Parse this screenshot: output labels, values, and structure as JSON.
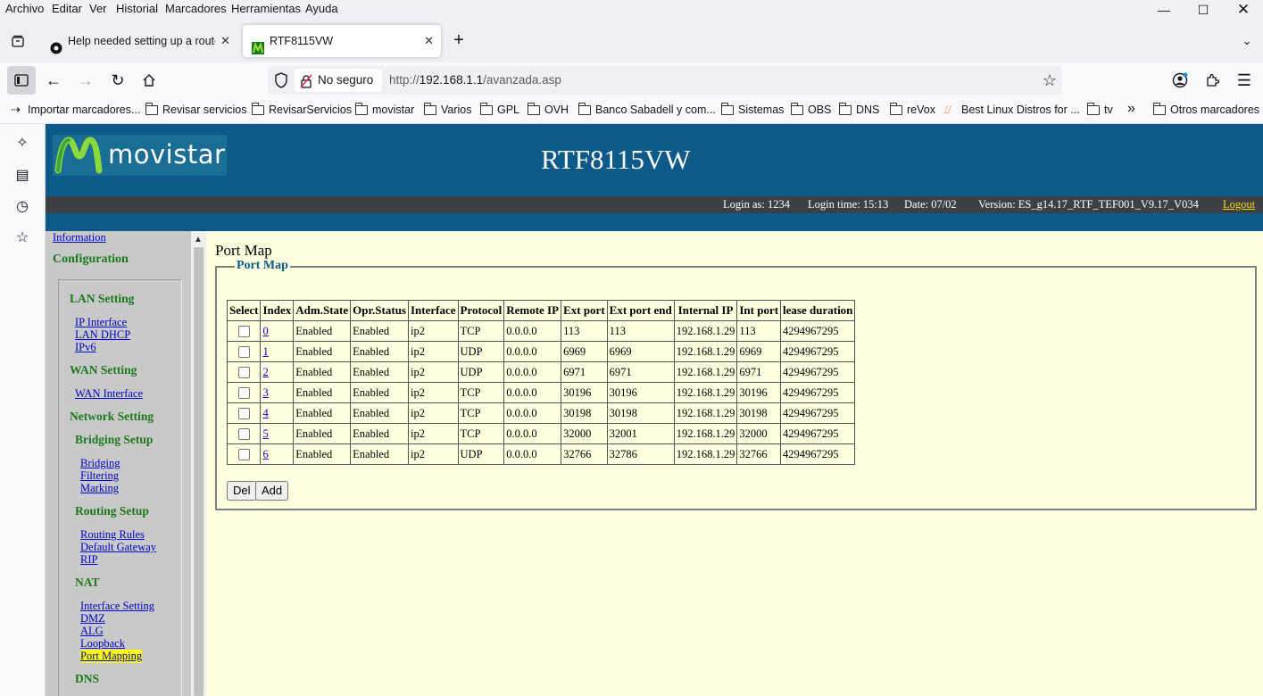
{
  "browser": {
    "menu": [
      "Archivo",
      "Editar",
      "Ver",
      "Historial",
      "Marcadores",
      "Herramientas",
      "Ayuda"
    ],
    "tabs": [
      {
        "title": "Help needed setting up a router"
      },
      {
        "title": "RTF8115VW"
      }
    ],
    "url": {
      "security_label": "No seguro",
      "prefix": "http://",
      "host": "192.168.1.1",
      "path": "/avanzada.asp"
    },
    "bookmarks": [
      "Importar marcadores...",
      "Revisar servicios",
      "RevisarServicios",
      "movistar",
      "Varios",
      "GPL",
      "OVH",
      "Banco Sabadell y com...",
      "Sistemas",
      "OBS",
      "DNS",
      "reVox",
      "Best Linux Distros for ...",
      "tv",
      "Otros marcadores"
    ],
    "overflow_glyph": "»"
  },
  "router": {
    "brand": "movistar",
    "model": "RTF8115VW",
    "info": {
      "login_as": "Login as: 1234",
      "login_time": "Login time: 15:13",
      "date": "Date: 07/02",
      "version": "Version: ES_g14.17_RTF_TEF001_V9.17_V034",
      "logout": "Logout"
    },
    "menu": {
      "information": "Information",
      "configuration": "Configuration",
      "lan_setting": "LAN Setting",
      "lan_items": [
        "IP Interface",
        "LAN DHCP",
        "IPv6"
      ],
      "wan_setting": "WAN Setting",
      "wan_items": [
        "WAN Interface"
      ],
      "network_setting": "Network Setting",
      "bridging_setup": "Bridging Setup",
      "bridging_items": [
        "Bridging",
        "Filtering",
        "Marking"
      ],
      "routing_setup": "Routing Setup",
      "routing_items": [
        "Routing Rules",
        "Default Gateway",
        "RIP"
      ],
      "nat": "NAT",
      "nat_items": [
        "Interface Setting",
        "DMZ",
        "ALG",
        "Loopback",
        "Port Mapping"
      ],
      "dns": "DNS"
    },
    "page_title": "Port Map",
    "legend": "Port Map",
    "table": {
      "headers": [
        "Select",
        "Index",
        "Adm.State",
        "Opr.Status",
        "Interface",
        "Protocol",
        "Remote IP",
        "Ext port",
        "Ext port end",
        "Internal IP",
        "Int port",
        "lease duration"
      ],
      "rows": [
        [
          "0",
          "Enabled",
          "Enabled",
          "ip2",
          "TCP",
          "0.0.0.0",
          "113",
          "113",
          "192.168.1.29",
          "113",
          "4294967295"
        ],
        [
          "1",
          "Enabled",
          "Enabled",
          "ip2",
          "UDP",
          "0.0.0.0",
          "6969",
          "6969",
          "192.168.1.29",
          "6969",
          "4294967295"
        ],
        [
          "2",
          "Enabled",
          "Enabled",
          "ip2",
          "UDP",
          "0.0.0.0",
          "6971",
          "6971",
          "192.168.1.29",
          "6971",
          "4294967295"
        ],
        [
          "3",
          "Enabled",
          "Enabled",
          "ip2",
          "TCP",
          "0.0.0.0",
          "30196",
          "30196",
          "192.168.1.29",
          "30196",
          "4294967295"
        ],
        [
          "4",
          "Enabled",
          "Enabled",
          "ip2",
          "TCP",
          "0.0.0.0",
          "30198",
          "30198",
          "192.168.1.29",
          "30198",
          "4294967295"
        ],
        [
          "5",
          "Enabled",
          "Enabled",
          "ip2",
          "TCP",
          "0.0.0.0",
          "32000",
          "32001",
          "192.168.1.29",
          "32000",
          "4294967295"
        ],
        [
          "6",
          "Enabled",
          "Enabled",
          "ip2",
          "UDP",
          "0.0.0.0",
          "32766",
          "32786",
          "192.168.1.29",
          "32766",
          "4294967295"
        ]
      ]
    },
    "buttons": {
      "del": "Del",
      "add": "Add"
    }
  },
  "colors": {
    "header_blue": "#0d5a8a",
    "content_bg": "#ffffe0",
    "menu_green": "#1a7a1a",
    "logout_yellow": "#ffd700"
  }
}
